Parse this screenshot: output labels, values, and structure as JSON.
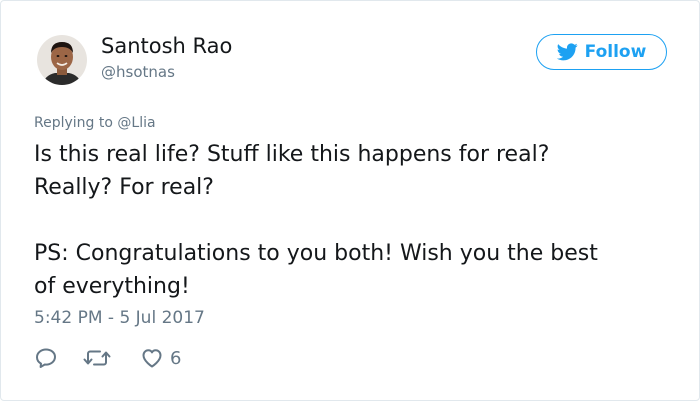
{
  "tweet": {
    "author": {
      "name": "Santosh Rao",
      "handle": "@hsotnas",
      "avatar_icon": "user-avatar"
    },
    "follow_button": {
      "label": "Follow",
      "icon": "twitter-bird-icon",
      "color": "#1da1f2"
    },
    "replying_to": {
      "prefix": "Replying to",
      "mention": "@Llia"
    },
    "text_lines": [
      "Is this real life? Stuff like this happens for real?",
      "Really? For real?",
      "PS: Congratulations to you both! Wish you the best",
      "of everything!"
    ],
    "timestamp": "5:42 PM - 5 Jul 2017",
    "actions": {
      "reply_icon": "reply-icon",
      "retweet_icon": "retweet-icon",
      "like_icon": "heart-icon",
      "like_count": "6"
    }
  },
  "colors": {
    "accent": "#1da1f2",
    "secondary_text": "#657786",
    "primary_text": "#14171a",
    "border": "#e1e8ed"
  }
}
